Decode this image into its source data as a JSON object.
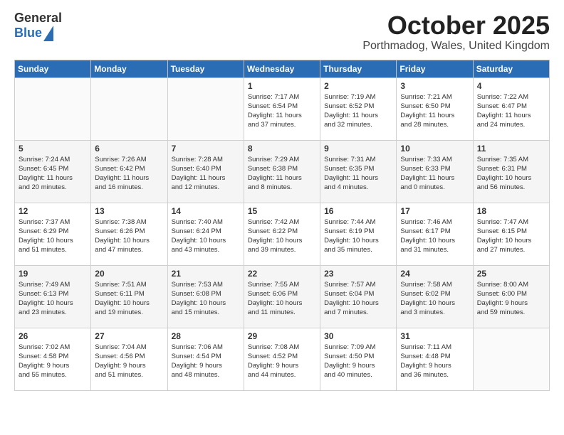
{
  "header": {
    "logo_general": "General",
    "logo_blue": "Blue",
    "month_title": "October 2025",
    "location": "Porthmadog, Wales, United Kingdom"
  },
  "days_of_week": [
    "Sunday",
    "Monday",
    "Tuesday",
    "Wednesday",
    "Thursday",
    "Friday",
    "Saturday"
  ],
  "weeks": [
    [
      {
        "day": "",
        "info": ""
      },
      {
        "day": "",
        "info": ""
      },
      {
        "day": "",
        "info": ""
      },
      {
        "day": "1",
        "info": "Sunrise: 7:17 AM\nSunset: 6:54 PM\nDaylight: 11 hours\nand 37 minutes."
      },
      {
        "day": "2",
        "info": "Sunrise: 7:19 AM\nSunset: 6:52 PM\nDaylight: 11 hours\nand 32 minutes."
      },
      {
        "day": "3",
        "info": "Sunrise: 7:21 AM\nSunset: 6:50 PM\nDaylight: 11 hours\nand 28 minutes."
      },
      {
        "day": "4",
        "info": "Sunrise: 7:22 AM\nSunset: 6:47 PM\nDaylight: 11 hours\nand 24 minutes."
      }
    ],
    [
      {
        "day": "5",
        "info": "Sunrise: 7:24 AM\nSunset: 6:45 PM\nDaylight: 11 hours\nand 20 minutes."
      },
      {
        "day": "6",
        "info": "Sunrise: 7:26 AM\nSunset: 6:42 PM\nDaylight: 11 hours\nand 16 minutes."
      },
      {
        "day": "7",
        "info": "Sunrise: 7:28 AM\nSunset: 6:40 PM\nDaylight: 11 hours\nand 12 minutes."
      },
      {
        "day": "8",
        "info": "Sunrise: 7:29 AM\nSunset: 6:38 PM\nDaylight: 11 hours\nand 8 minutes."
      },
      {
        "day": "9",
        "info": "Sunrise: 7:31 AM\nSunset: 6:35 PM\nDaylight: 11 hours\nand 4 minutes."
      },
      {
        "day": "10",
        "info": "Sunrise: 7:33 AM\nSunset: 6:33 PM\nDaylight: 11 hours\nand 0 minutes."
      },
      {
        "day": "11",
        "info": "Sunrise: 7:35 AM\nSunset: 6:31 PM\nDaylight: 10 hours\nand 56 minutes."
      }
    ],
    [
      {
        "day": "12",
        "info": "Sunrise: 7:37 AM\nSunset: 6:29 PM\nDaylight: 10 hours\nand 51 minutes."
      },
      {
        "day": "13",
        "info": "Sunrise: 7:38 AM\nSunset: 6:26 PM\nDaylight: 10 hours\nand 47 minutes."
      },
      {
        "day": "14",
        "info": "Sunrise: 7:40 AM\nSunset: 6:24 PM\nDaylight: 10 hours\nand 43 minutes."
      },
      {
        "day": "15",
        "info": "Sunrise: 7:42 AM\nSunset: 6:22 PM\nDaylight: 10 hours\nand 39 minutes."
      },
      {
        "day": "16",
        "info": "Sunrise: 7:44 AM\nSunset: 6:19 PM\nDaylight: 10 hours\nand 35 minutes."
      },
      {
        "day": "17",
        "info": "Sunrise: 7:46 AM\nSunset: 6:17 PM\nDaylight: 10 hours\nand 31 minutes."
      },
      {
        "day": "18",
        "info": "Sunrise: 7:47 AM\nSunset: 6:15 PM\nDaylight: 10 hours\nand 27 minutes."
      }
    ],
    [
      {
        "day": "19",
        "info": "Sunrise: 7:49 AM\nSunset: 6:13 PM\nDaylight: 10 hours\nand 23 minutes."
      },
      {
        "day": "20",
        "info": "Sunrise: 7:51 AM\nSunset: 6:11 PM\nDaylight: 10 hours\nand 19 minutes."
      },
      {
        "day": "21",
        "info": "Sunrise: 7:53 AM\nSunset: 6:08 PM\nDaylight: 10 hours\nand 15 minutes."
      },
      {
        "day": "22",
        "info": "Sunrise: 7:55 AM\nSunset: 6:06 PM\nDaylight: 10 hours\nand 11 minutes."
      },
      {
        "day": "23",
        "info": "Sunrise: 7:57 AM\nSunset: 6:04 PM\nDaylight: 10 hours\nand 7 minutes."
      },
      {
        "day": "24",
        "info": "Sunrise: 7:58 AM\nSunset: 6:02 PM\nDaylight: 10 hours\nand 3 minutes."
      },
      {
        "day": "25",
        "info": "Sunrise: 8:00 AM\nSunset: 6:00 PM\nDaylight: 9 hours\nand 59 minutes."
      }
    ],
    [
      {
        "day": "26",
        "info": "Sunrise: 7:02 AM\nSunset: 4:58 PM\nDaylight: 9 hours\nand 55 minutes."
      },
      {
        "day": "27",
        "info": "Sunrise: 7:04 AM\nSunset: 4:56 PM\nDaylight: 9 hours\nand 51 minutes."
      },
      {
        "day": "28",
        "info": "Sunrise: 7:06 AM\nSunset: 4:54 PM\nDaylight: 9 hours\nand 48 minutes."
      },
      {
        "day": "29",
        "info": "Sunrise: 7:08 AM\nSunset: 4:52 PM\nDaylight: 9 hours\nand 44 minutes."
      },
      {
        "day": "30",
        "info": "Sunrise: 7:09 AM\nSunset: 4:50 PM\nDaylight: 9 hours\nand 40 minutes."
      },
      {
        "day": "31",
        "info": "Sunrise: 7:11 AM\nSunset: 4:48 PM\nDaylight: 9 hours\nand 36 minutes."
      },
      {
        "day": "",
        "info": ""
      }
    ]
  ]
}
